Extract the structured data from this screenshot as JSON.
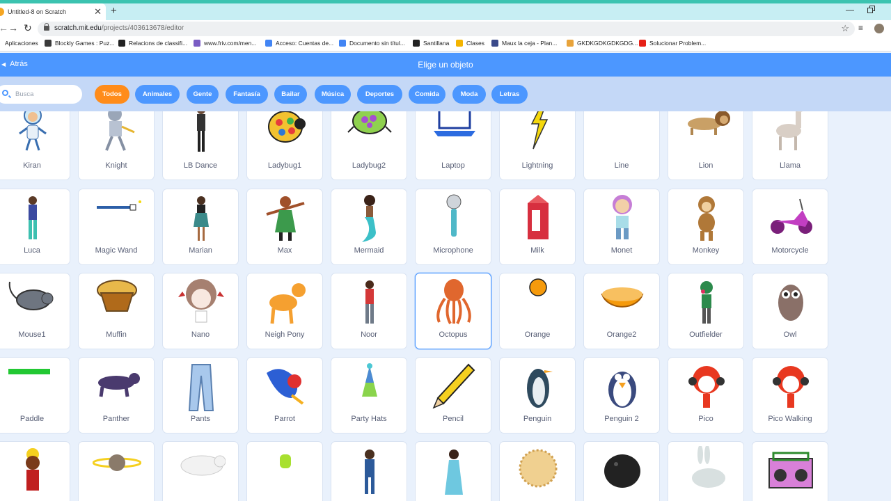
{
  "browser": {
    "tab_title": "Untitled-8 on Scratch",
    "url_host": "scratch.mit.edu",
    "url_path": "/projects/403613678/editor",
    "bookmarks": [
      {
        "label": "Aplicaciones",
        "color": "#4c8bf5"
      },
      {
        "label": "Blockly Games : Puz...",
        "color": "#3a3a3a"
      },
      {
        "label": "Relacions de classifi...",
        "color": "#222222"
      },
      {
        "label": "www.friv.com/men...",
        "color": "#7a5cc4"
      },
      {
        "label": "Acceso: Cuentas de...",
        "color": "#4285f4"
      },
      {
        "label": "Documento sin títul...",
        "color": "#4285f4"
      },
      {
        "label": "Santillana",
        "color": "#222222"
      },
      {
        "label": "Clases",
        "color": "#f4b400"
      },
      {
        "label": "Maux la ceja - Plan...",
        "color": "#3a4a8a"
      },
      {
        "label": "GKDKGDKGDKGDG...",
        "color": "#e8a33b"
      },
      {
        "label": "Solucionar Problem...",
        "color": "#e62117"
      }
    ]
  },
  "header": {
    "back_label": "Atrás",
    "title": "Elige un objeto"
  },
  "filters": {
    "search_placeholder": "Busca",
    "chips": [
      "Todos",
      "Animales",
      "Gente",
      "Fantasía",
      "Bailar",
      "Música",
      "Deportes",
      "Comida",
      "Moda",
      "Letras"
    ],
    "active": "Todos"
  },
  "colors": {
    "header_blue": "#4c97ff",
    "active_chip": "#ff8c1a",
    "filter_bar": "#c4d8f7"
  },
  "sprites": [
    [
      "Kiran",
      "Knight",
      "LB Dance",
      "Ladybug1",
      "Ladybug2",
      "Laptop",
      "Lightning",
      "Line",
      "Lion",
      "Llama"
    ],
    [
      "Luca",
      "Magic Wand",
      "Marian",
      "Max",
      "Mermaid",
      "Microphone",
      "Milk",
      "Monet",
      "Monkey",
      "Motorcycle"
    ],
    [
      "Mouse1",
      "Muffin",
      "Nano",
      "Neigh Pony",
      "Noor",
      "Octopus",
      "Orange",
      "Orange2",
      "Outfielder",
      "Owl"
    ],
    [
      "Paddle",
      "Panther",
      "Pants",
      "Parrot",
      "Party Hats",
      "Pencil",
      "Penguin",
      "Penguin 2",
      "Pico",
      "Pico Walking"
    ],
    [
      "",
      "",
      "",
      "",
      "",
      "",
      "",
      "",
      "",
      ""
    ]
  ],
  "selected_sprite": "Octopus"
}
